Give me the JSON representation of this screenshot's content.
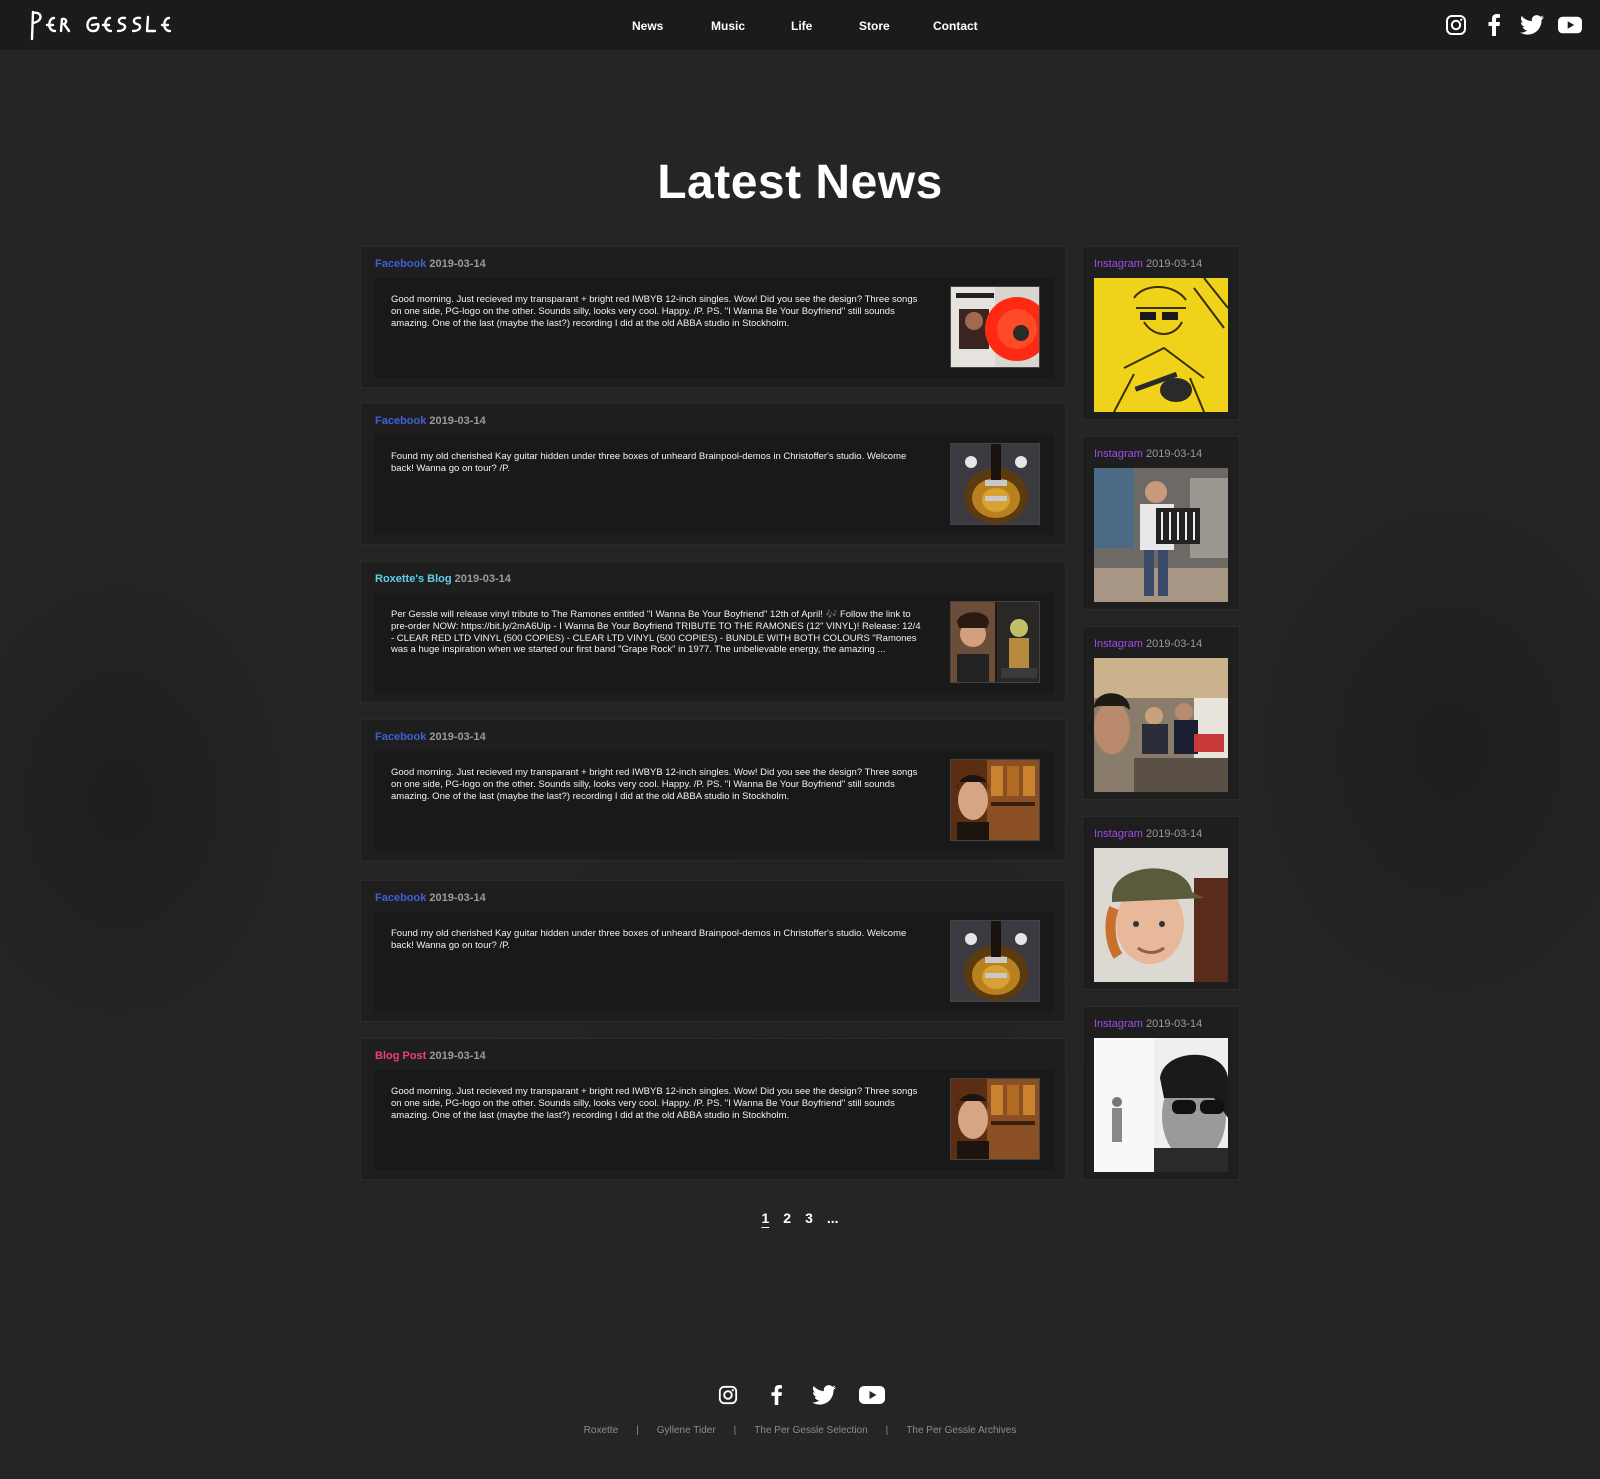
{
  "header": {
    "logo_text": "Per Gessle",
    "nav": [
      "News",
      "Music",
      "Life",
      "Store",
      "Contact"
    ],
    "social_icons": [
      "instagram-icon",
      "facebook-icon",
      "twitter-icon",
      "youtube-icon"
    ]
  },
  "main": {
    "title": "Latest News",
    "news": [
      {
        "source": "Facebook",
        "source_color": "#3f5fd6",
        "date": "2019-03-14",
        "text": "Good morning. Just recieved my transparant + bright red IWBYB 12-inch singles. Wow! Did you see the design? Three songs on one side, PG-logo on the other. Sounds silly, looks very cool. Happy. /P. PS. \"I Wanna Be Your Boyfriend\" still sounds amazing. One of the last (maybe the last?) recording I did at the old ABBA studio in Stockholm.",
        "thumb": "red-vinyl-record-image"
      },
      {
        "source": "Facebook",
        "source_color": "#3f5fd6",
        "date": "2019-03-14",
        "text": "Found my old cherished Kay guitar hidden under three boxes of unheard Brainpool-demos in Christoffer's studio. Welcome back! Wanna go on tour? /P.",
        "thumb": "kay-guitar-image"
      },
      {
        "source": "Roxette's Blog",
        "source_color": "#5fd0ea",
        "date": "2019-03-14",
        "text": "Per Gessle will release vinyl tribute to The Ramones entitled \"I Wanna Be Your Boyfriend\" 12th of April! 🎶 Follow the link to pre-order NOW: https://bit.ly/2mA6Uip - I Wanna Be Your Boyfriend TRIBUTE TO THE RAMONES (12\" VINYL)! Release: 12/4 - CLEAR RED LTD VINYL (500 COPIES) - CLEAR LTD VINYL (500 COPIES) - BUNDLE WITH BOTH COLOURS \"Ramones was a huge inspiration when we started our first band \"Grape Rock\" in 1977. The unbelievable energy, the amazing ...",
        "thumb": "ramones-tribute-cover-image"
      },
      {
        "source": "Facebook",
        "source_color": "#3f5fd6",
        "date": "2019-03-14",
        "text": "Good morning. Just recieved my transparant + bright red IWBYB 12-inch singles. Wow! Did you see the design? Three songs on one side, PG-logo on the other. Sounds silly, looks very cool. Happy. /P. PS. \"I Wanna Be Your Boyfriend\" still sounds amazing. One of the last (maybe the last?) recording I did at the old ABBA studio in Stockholm.",
        "thumb": "portrait-bookshelf-image"
      },
      {
        "source": "Facebook",
        "source_color": "#3f5fd6",
        "date": "2019-03-14",
        "text": "Found my old cherished Kay guitar hidden under three boxes of unheard Brainpool-demos in Christoffer's studio. Welcome back! Wanna go on tour? /P.",
        "thumb": "kay-guitar-image"
      },
      {
        "source": "Blog Post",
        "source_color": "#f0406e",
        "date": "2019-03-14",
        "text": "Good morning. Just recieved my transparant + bright red IWBYB 12-inch singles. Wow! Did you see the design? Three songs on one side, PG-logo on the other. Sounds silly, looks very cool. Happy. /P. PS. \"I Wanna Be Your Boyfriend\" still sounds amazing. One of the last (maybe the last?) recording I did at the old ABBA studio in Stockholm.",
        "thumb": "portrait-bookshelf-image"
      }
    ],
    "instagram": [
      {
        "source": "Instagram",
        "date": "2019-03-14",
        "image": "yellow-guitar-illustration"
      },
      {
        "source": "Instagram",
        "date": "2019-03-14",
        "image": "accordion-player-photo"
      },
      {
        "source": "Instagram",
        "date": "2019-03-14",
        "image": "group-selfie-photo"
      },
      {
        "source": "Instagram",
        "date": "2019-03-14",
        "image": "cap-portrait-photo"
      },
      {
        "source": "Instagram",
        "date": "2019-03-14",
        "image": "sunglasses-bw-photo"
      }
    ],
    "pagination": [
      "1",
      "2",
      "3",
      "..."
    ]
  },
  "footer": {
    "social_icons": [
      "instagram-icon",
      "facebook-icon",
      "twitter-icon",
      "youtube-icon"
    ],
    "links": [
      "Roxette",
      "Gyllene Tider",
      "The Per Gessle Selection",
      "The Per Gessle Archives"
    ],
    "separator": "|"
  },
  "colors": {
    "background": "#262525",
    "header": "#1b1b1b",
    "card": "#1f1e1e",
    "instagram": "#a24be8",
    "facebook": "#3f5fd6",
    "roxette_blog": "#5fd0ea",
    "blog_post": "#f0406e"
  }
}
